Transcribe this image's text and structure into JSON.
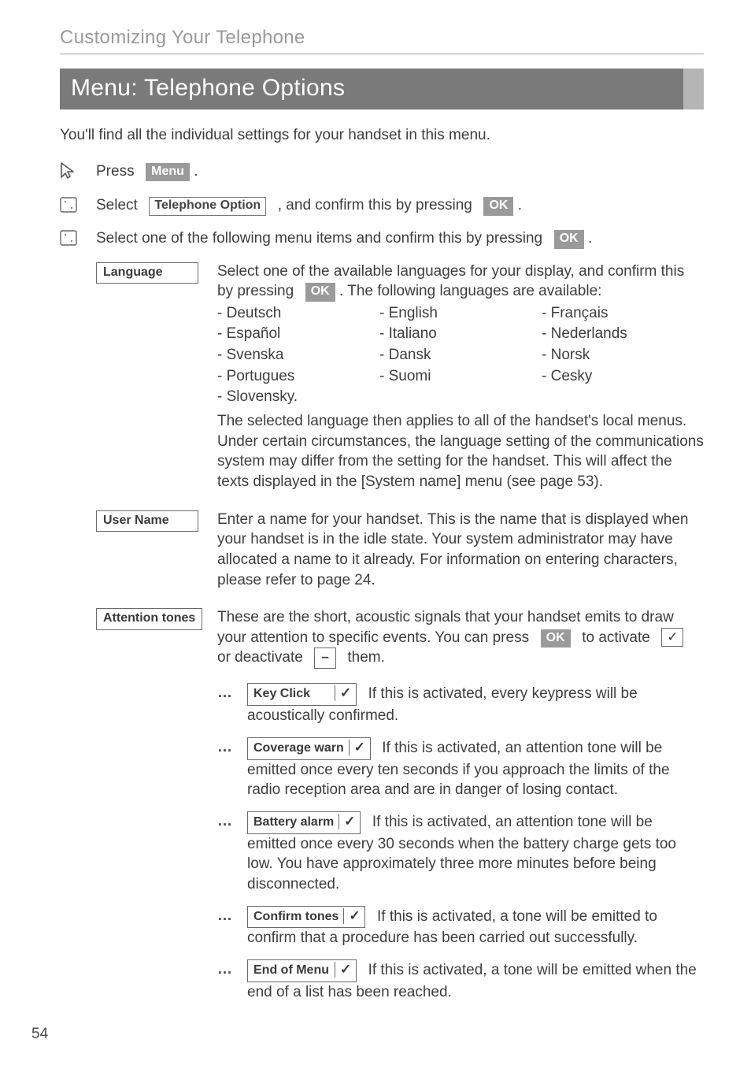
{
  "chapter": "Customizing Your Telephone",
  "title": "Menu: Telephone Options",
  "intro": "You'll find all the individual settings for your handset in this menu.",
  "steps": {
    "press_label": "Press",
    "menu_chip": "Menu",
    "select_label": "Select",
    "telephone_option_chip": "Telephone Option",
    "confirm_txt": ", and confirm this by pressing",
    "ok_chip": "OK",
    "select_following": "Select one of the following menu items and confirm this by pressing"
  },
  "language": {
    "label": "Language",
    "line1a": "Select one of the available languages for your display, and confirm this by pressing",
    "line1b": ". The following languages are available:",
    "col1": [
      "- Deutsch",
      "- Español",
      "- Svenska",
      "- Portugues",
      "- Slovensky."
    ],
    "col2": [
      "- English",
      "- Italiano",
      "- Dansk",
      "- Suomi"
    ],
    "col3": [
      "- Français",
      "- Nederlands",
      "- Norsk",
      "- Cesky"
    ],
    "para2": "The selected language then applies to all of the handset's local menus. Under certain circumstances, the language setting of the communications system may differ from the setting for the handset. This will affect the texts displayed in the [System name] menu (see page 53)."
  },
  "username": {
    "label": "User Name",
    "text": "Enter a name for your handset. This is the name that is displayed when your handset is in the idle state. Your system administrator may have allocated a name to it already. For information on entering characters, please refer to page 24."
  },
  "attention": {
    "label": "Attention tones",
    "intro_a": "These are the short, acoustic signals that your handset emits to draw your attention to specific events. You can press",
    "intro_b": "to activate",
    "intro_c": "or deactivate",
    "intro_d": "them.",
    "items": [
      {
        "name": "Key Click",
        "text": "If this is activated, every keypress will be acoustically confirmed."
      },
      {
        "name": "Coverage warn",
        "text": "If this is activated, an attention tone will be emitted once every ten seconds if you approach the limits of the radio reception area and are in danger of losing contact."
      },
      {
        "name": "Battery alarm",
        "text": "If this is activated, an attention tone will be emitted once every 30 seconds when the battery charge gets too low. You have approximately three more minutes before being disconnected."
      },
      {
        "name": "Confirm tones",
        "text": "If this is activated, a tone will be emitted to confirm that a procedure has been carried out successfully."
      },
      {
        "name": "End of Menu",
        "text": "If this is activated, a tone will be emitted when the end of a list has been reached."
      }
    ]
  },
  "page_num": "54"
}
